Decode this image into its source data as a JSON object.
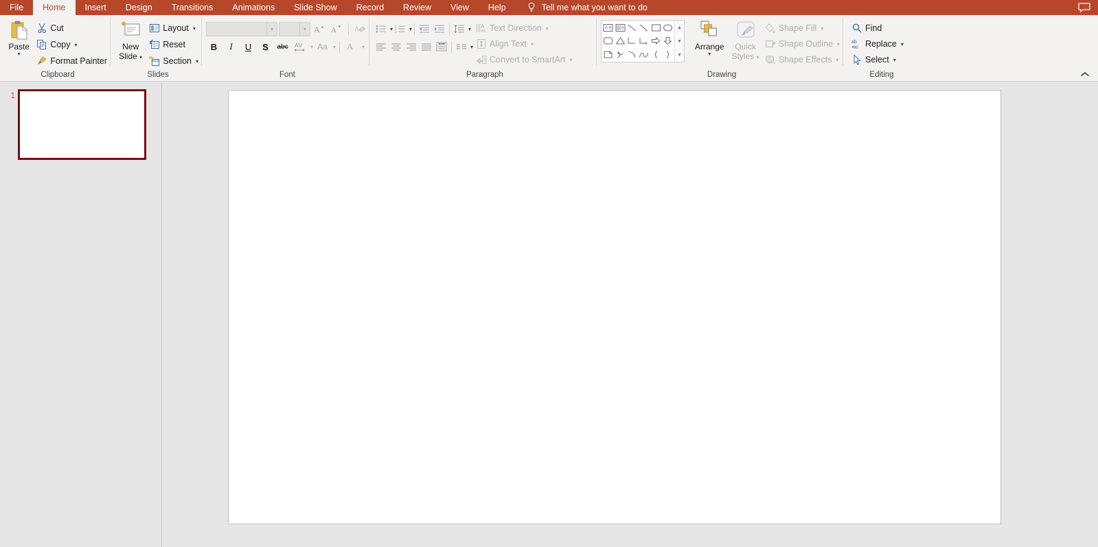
{
  "tabs": [
    {
      "label": "File",
      "active": false
    },
    {
      "label": "Home",
      "active": true
    },
    {
      "label": "Insert",
      "active": false
    },
    {
      "label": "Design",
      "active": false
    },
    {
      "label": "Transitions",
      "active": false
    },
    {
      "label": "Animations",
      "active": false
    },
    {
      "label": "Slide Show",
      "active": false
    },
    {
      "label": "Record",
      "active": false
    },
    {
      "label": "Review",
      "active": false
    },
    {
      "label": "View",
      "active": false
    },
    {
      "label": "Help",
      "active": false
    }
  ],
  "tellme": {
    "label": "Tell me what you want to do",
    "icon": "lightbulb-icon"
  },
  "comment_icon": "comment-icon",
  "colors": {
    "ribbon_accent": "#b7472a",
    "ribbon_background": "#f3f2f1",
    "workspace_background": "#e6e6e6",
    "thumbnail_selected_border": "#7b0a15",
    "slide_number": "#c55b3c",
    "disabled_text": "#b0aeac"
  },
  "ribbon": {
    "collapse_label": "collapse-ribbon",
    "groups": [
      {
        "name": "clipboard",
        "label": "Clipboard",
        "has_launcher": true,
        "paste": {
          "label": "Paste",
          "icon": "paste-icon",
          "has_caret": true
        },
        "items": [
          {
            "label": "Cut",
            "icon": "cut-icon",
            "has_caret": false
          },
          {
            "label": "Copy",
            "icon": "copy-icon",
            "has_caret": true
          },
          {
            "label": "Format Painter",
            "icon": "format-painter-icon",
            "has_caret": false
          }
        ]
      },
      {
        "name": "slides",
        "label": "Slides",
        "has_launcher": false,
        "new_slide": {
          "label_line1": "New",
          "label_line2": "Slide",
          "icon": "new-slide-icon",
          "has_caret": true
        },
        "items": [
          {
            "label": "Layout",
            "icon": "layout-icon",
            "has_caret": true
          },
          {
            "label": "Reset",
            "icon": "reset-icon",
            "has_caret": false
          },
          {
            "label": "Section",
            "icon": "section-icon",
            "has_caret": true
          }
        ]
      },
      {
        "name": "font",
        "label": "Font",
        "has_launcher": true,
        "font_name": {
          "value": "",
          "placeholder": ""
        },
        "font_size": {
          "value": "",
          "placeholder": ""
        },
        "buttons_row1": [
          {
            "name": "increase-font-size",
            "glyph": "A",
            "tip": "Increase Font Size"
          },
          {
            "name": "decrease-font-size",
            "glyph": "A",
            "tip": "Decrease Font Size"
          },
          {
            "name": "clear-formatting",
            "glyph": "",
            "tip": "Clear All Formatting"
          }
        ],
        "buttons_row2": [
          {
            "name": "bold",
            "glyph": "B"
          },
          {
            "name": "italic",
            "glyph": "I"
          },
          {
            "name": "underline",
            "glyph": "U"
          },
          {
            "name": "text-shadow",
            "glyph": "S"
          },
          {
            "name": "strikethrough",
            "glyph": "abc"
          },
          {
            "name": "character-spacing",
            "glyph": "AV"
          },
          {
            "name": "change-case",
            "glyph": "Aa"
          },
          {
            "name": "font-color",
            "glyph": "A"
          }
        ]
      },
      {
        "name": "paragraph",
        "label": "Paragraph",
        "has_launcher": true,
        "buttons_row1": [
          {
            "name": "bullets",
            "has_caret": true
          },
          {
            "name": "numbering",
            "has_caret": true
          },
          {
            "name": "decrease-indent",
            "has_caret": false
          },
          {
            "name": "increase-indent",
            "has_caret": false
          },
          {
            "name": "line-spacing",
            "has_caret": true
          }
        ],
        "buttons_row2": [
          {
            "name": "align-left",
            "has_caret": false
          },
          {
            "name": "align-center",
            "has_caret": false
          },
          {
            "name": "align-right",
            "has_caret": false
          },
          {
            "name": "justify",
            "has_caret": false
          },
          {
            "name": "columns-text",
            "has_caret": false
          },
          {
            "name": "columns",
            "has_caret": true
          }
        ],
        "items": [
          {
            "label": "Text Direction",
            "icon": "text-direction-icon",
            "has_caret": true
          },
          {
            "label": "Align Text",
            "icon": "align-text-icon",
            "has_caret": true
          },
          {
            "label": "Convert to SmartArt",
            "icon": "smartart-icon",
            "has_caret": true
          }
        ]
      },
      {
        "name": "drawing",
        "label": "Drawing",
        "has_launcher": true,
        "shapes": [
          "text-box-shape",
          "vertical-text-box-shape",
          "line-shape",
          "arrow-shape",
          "rectangle-shape",
          "oval-shape",
          "rounded-rectangle-shape",
          "triangle-shape",
          "elbow-connector-shape",
          "elbow-arrow-connector-shape",
          "right-arrow-shape",
          "down-arrow-shape",
          "folded-corner-shape",
          "scribble-shape",
          "arc-shape",
          "curve-shape",
          "left-brace-shape",
          "right-brace-shape"
        ],
        "gallery_scroll": [
          "scroll-up-icon",
          "scroll-down-icon",
          "more-shapes-icon"
        ],
        "arrange": {
          "label": "Arrange",
          "icon": "arrange-icon",
          "has_caret": true
        },
        "quick_styles": {
          "label_line1": "Quick",
          "label_line2": "Styles",
          "icon": "quick-styles-icon",
          "has_caret": true
        },
        "items": [
          {
            "label": "Shape Fill",
            "icon": "shape-fill-icon",
            "has_caret": true
          },
          {
            "label": "Shape Outline",
            "icon": "shape-outline-icon",
            "has_caret": true
          },
          {
            "label": "Shape Effects",
            "icon": "shape-effects-icon",
            "has_caret": true
          }
        ]
      },
      {
        "name": "editing",
        "label": "Editing",
        "has_launcher": false,
        "items": [
          {
            "label": "Find",
            "icon": "find-icon",
            "has_caret": false
          },
          {
            "label": "Replace",
            "icon": "replace-icon",
            "has_caret": true
          },
          {
            "label": "Select",
            "icon": "select-icon",
            "has_caret": true
          }
        ]
      }
    ]
  },
  "thumbnails": {
    "slides": [
      {
        "number": "1",
        "selected": true
      }
    ]
  },
  "slide": {
    "name": "slide-canvas",
    "content": ""
  }
}
